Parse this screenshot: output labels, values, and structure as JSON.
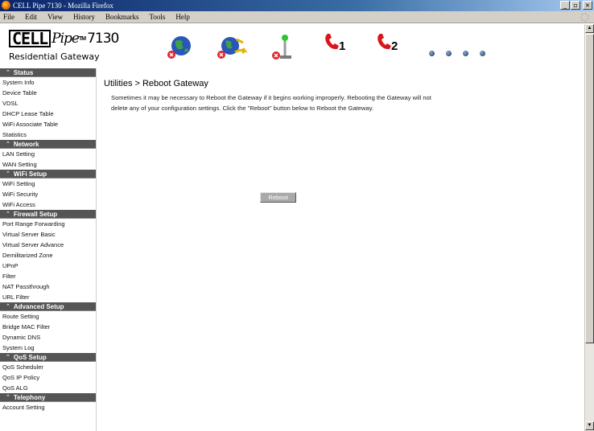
{
  "window": {
    "title": "CELL Pipe 7130 - Mozilla Firefox",
    "buttons": {
      "minimize": "_",
      "maximize": "▫",
      "close": "×"
    }
  },
  "menubar": {
    "items": [
      "File",
      "Edit",
      "View",
      "History",
      "Bookmarks",
      "Tools",
      "Help"
    ]
  },
  "logo": {
    "cell": "CELL",
    "pipe": "Pipe",
    "tm": "TM",
    "model": "7130",
    "subtitle": "Residential Gateway"
  },
  "status_icons": {
    "line1_label": "1",
    "line2_label": "2",
    "names": [
      "globe-status-icon",
      "network-status-icon",
      "antenna-status-icon",
      "phone-line-1-icon",
      "phone-line-2-icon"
    ],
    "colors": {
      "phone": "#d9151b",
      "globe": "#2a56b8",
      "antenna_led": "#2fc42f",
      "error": "#e2252b"
    }
  },
  "sidebar": {
    "sections": [
      {
        "title": "Status",
        "items": [
          "System Info",
          "Device Table",
          "VDSL",
          "DHCP Lease Table",
          "WiFi Associate Table",
          "Statistics"
        ]
      },
      {
        "title": "Network",
        "items": [
          "LAN Setting",
          "WAN Setting"
        ]
      },
      {
        "title": "WiFi Setup",
        "items": [
          "WiFi Setting",
          "WiFi Security",
          "WiFi Access"
        ]
      },
      {
        "title": "Firewall Setup",
        "items": [
          "Port Range Forwarding",
          "Virtual Server Basic",
          "Virtual Server Advance",
          "Demilitarized Zone",
          "UPnP",
          "Filter",
          "NAT Passthrough",
          "URL Filter"
        ]
      },
      {
        "title": "Advanced Setup",
        "items": [
          "Route Setting",
          "Bridge MAC Filter",
          "Dynamic DNS",
          "System Log"
        ]
      },
      {
        "title": "QoS Setup",
        "items": [
          "QoS Scheduler",
          "QoS IP Policy",
          "QoS ALG"
        ]
      },
      {
        "title": "Telephony",
        "items": [
          "Account Setting"
        ]
      }
    ]
  },
  "main": {
    "title": "Utilities > Reboot Gateway",
    "description": "Sometimes it may be necessary to Reboot the Gateway if it begins working improperly. Rebooting the Gateway will not delete any of your configuration settings. Click the \"Reboot\" button below to Reboot the Gateway.",
    "reboot_label": "Reboot"
  },
  "colors": {
    "section_header_bg": "#555555",
    "title_bar": "#0a246a",
    "button_bg": "#a9a9a9"
  }
}
